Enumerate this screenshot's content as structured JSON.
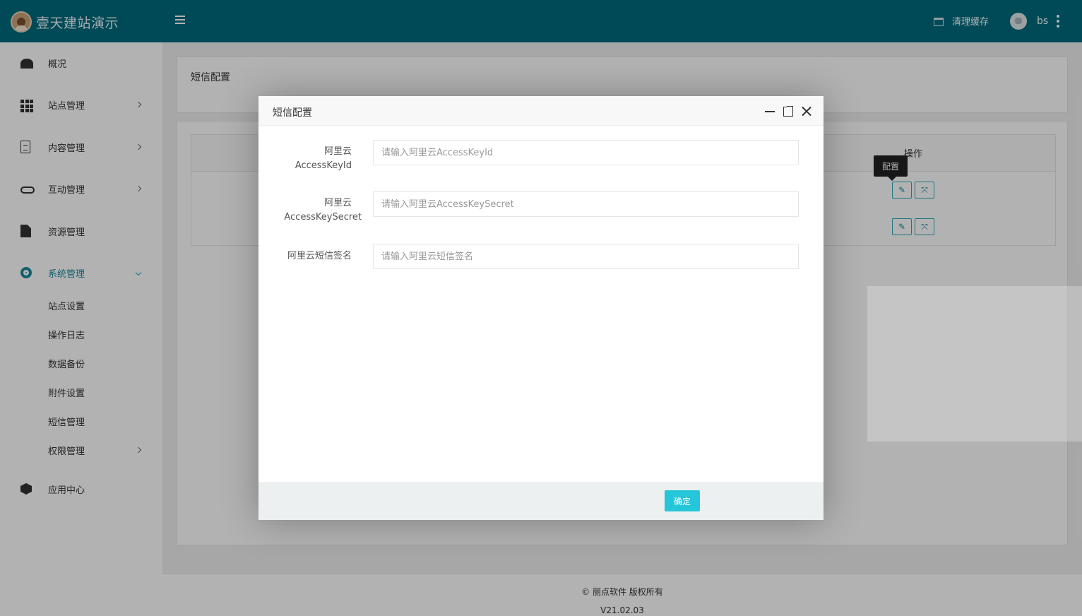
{
  "header": {
    "logo_text": "壹天建站演示",
    "clear_cache_label": "清理缓存",
    "username": "bs"
  },
  "sidebar": {
    "items": [
      {
        "label": "概况",
        "icon": "dashboard-icon"
      },
      {
        "label": "站点管理",
        "icon": "grid-icon"
      },
      {
        "label": "内容管理",
        "icon": "document-icon"
      },
      {
        "label": "互动管理",
        "icon": "handshake-icon"
      },
      {
        "label": "资源管理",
        "icon": "file-icon"
      },
      {
        "label": "系统管理",
        "icon": "gear-icon"
      },
      {
        "label": "应用中心",
        "icon": "cube-icon"
      }
    ],
    "sub_items": [
      "站点设置",
      "操作日志",
      "数据备份",
      "附件设置",
      "短信管理",
      "权限管理"
    ]
  },
  "main": {
    "card_title": "短信配置",
    "table": {
      "op_header": "操作"
    },
    "tooltip": "配置",
    "footer_copyright": "© 丽点软件 版权所有",
    "footer_version": "V21.02.03"
  },
  "modal": {
    "title": "短信配置",
    "fields": [
      {
        "label_line1": "阿里云",
        "label_line2": "AccessKeyId",
        "placeholder": "请输入阿里云AccessKeyId",
        "value": ""
      },
      {
        "label_line1": "阿里云",
        "label_line2": "AccessKeySecret",
        "placeholder": "请输入阿里云AccessKeySecret",
        "value": ""
      },
      {
        "label_line1": "阿里云短信签名",
        "label_line2": "",
        "placeholder": "请输入阿里云短信签名",
        "value": ""
      }
    ],
    "confirm_label": "确定"
  },
  "colors": {
    "header_bg": "#016a7e",
    "accent": "#17899c",
    "button": "#26c6da"
  }
}
